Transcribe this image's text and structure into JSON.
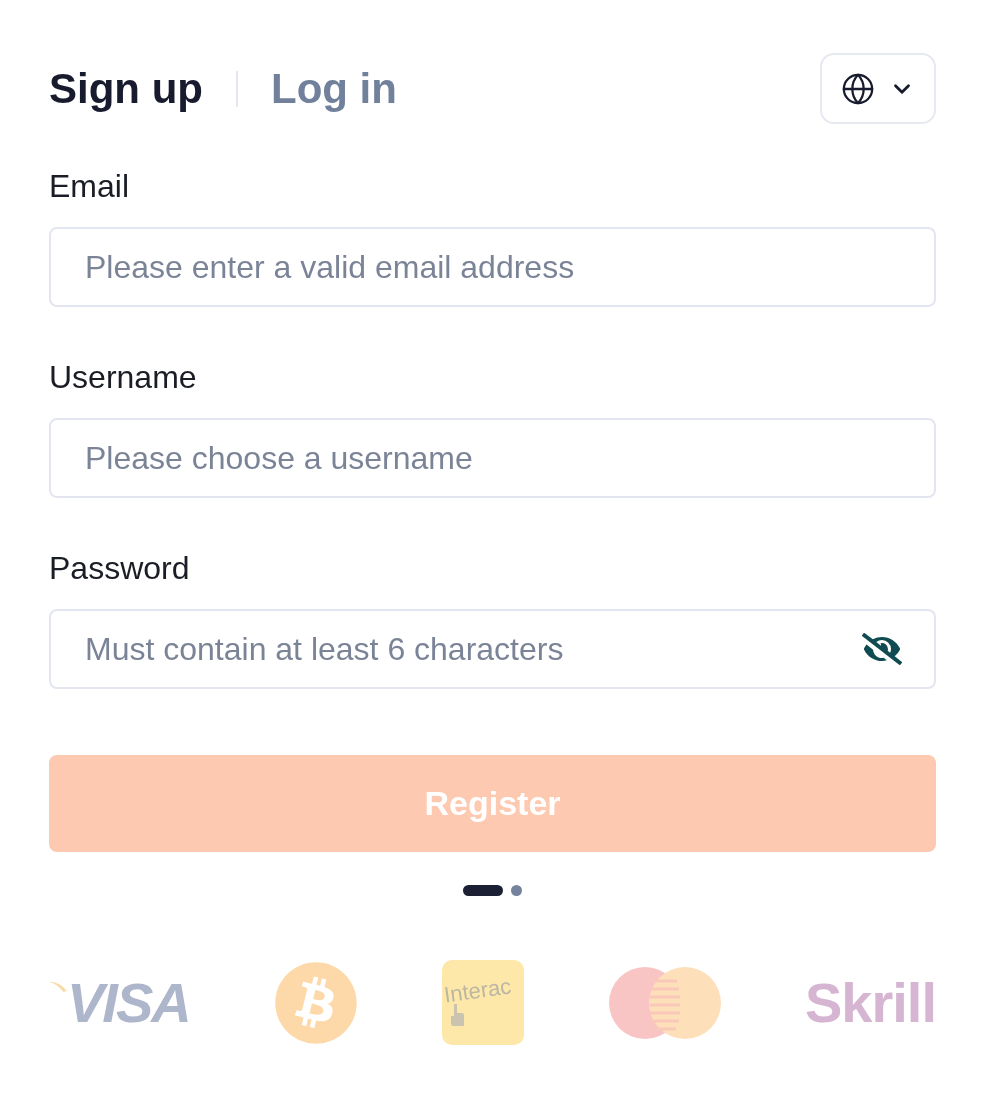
{
  "tabs": [
    {
      "label": "Sign up",
      "selected": true
    },
    {
      "label": "Log in",
      "selected": false
    }
  ],
  "fields": [
    {
      "kind": "email",
      "label": "Email",
      "placeholder": "Please enter a valid email address"
    },
    {
      "kind": "text",
      "label": "Username",
      "placeholder": "Please choose a username"
    },
    {
      "kind": "password",
      "label": "Password",
      "placeholder": "Must contain at least 6 characters",
      "revealed": false
    }
  ],
  "register": {
    "label": "Register",
    "disabled": true
  },
  "dots": [
    {
      "selected": true
    },
    {
      "selected": false
    }
  ],
  "payments": [
    {
      "kind": "visa",
      "label": "VISA"
    },
    {
      "kind": "bitcoin"
    },
    {
      "kind": "interac",
      "label": "Interac"
    },
    {
      "kind": "mastercard"
    },
    {
      "kind": "skrill",
      "label": "Skrill"
    }
  ]
}
